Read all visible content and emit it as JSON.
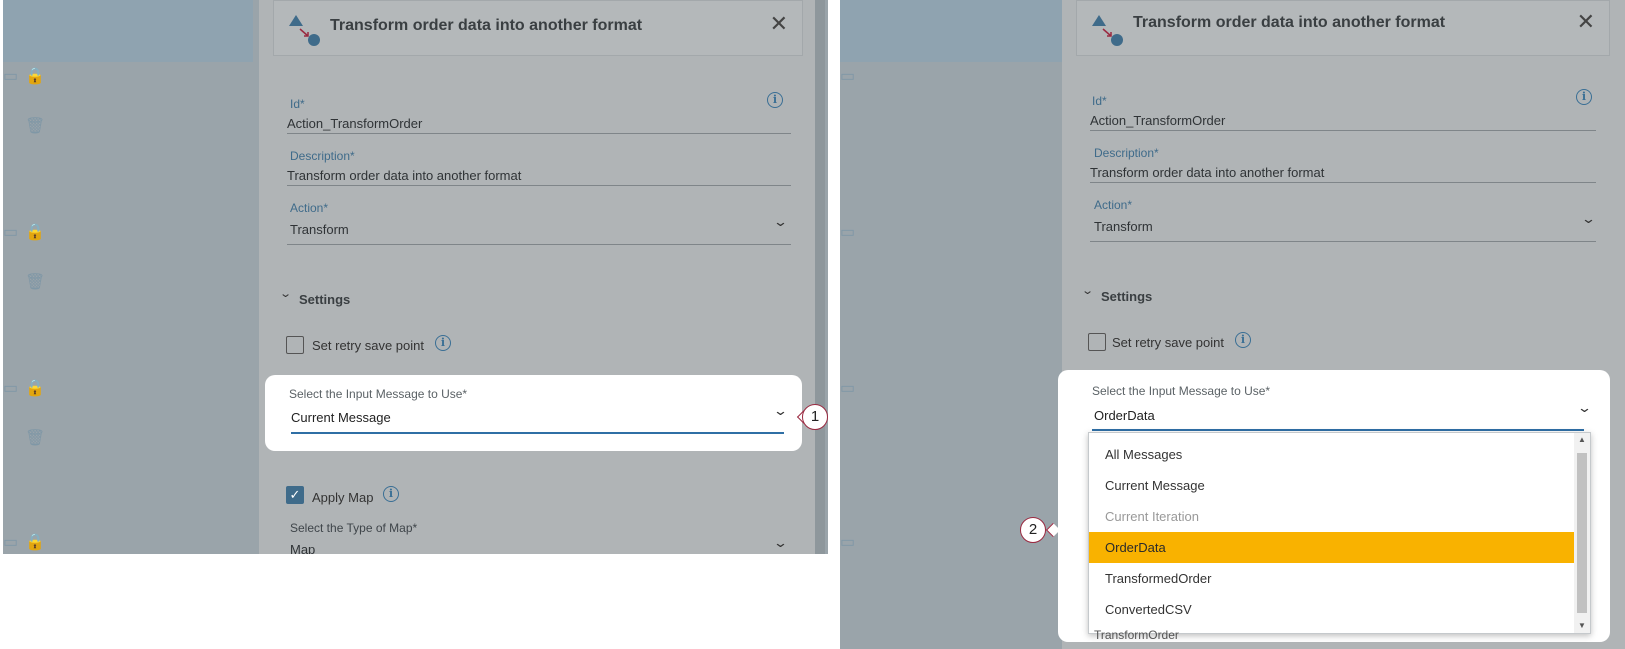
{
  "left": {
    "header_title": "Transform order data into another format",
    "id_label": "Id*",
    "id_value": "Action_TransformOrder",
    "description_label": "Description*",
    "description_value": "Transform order data into another format",
    "action_label": "Action*",
    "action_value": "Transform",
    "settings_label": "Settings",
    "retry_label": "Set retry save point",
    "input_label": "Select the Input Message to Use*",
    "input_value": "Current Message",
    "callout": "1",
    "apply_map_label": "Apply Map",
    "map_type_label": "Select the Type of Map*",
    "map_type_value": "Map"
  },
  "right": {
    "header_title": "Transform order data into another format",
    "id_label": "Id*",
    "id_value": "Action_TransformOrder",
    "description_label": "Description*",
    "description_value": "Transform order data into another format",
    "action_label": "Action*",
    "action_value": "Transform",
    "settings_label": "Settings",
    "retry_label": "Set retry save point",
    "input_label": "Select the Input Message to Use*",
    "input_value": "OrderData",
    "callout": "2",
    "options": [
      "All Messages",
      "Current Message",
      "Current Iteration",
      "OrderData",
      "TransformedOrder",
      "ConvertedCSV"
    ],
    "selected_option": "OrderData",
    "disabled_option": "Current Iteration",
    "below_value": "TransformOrder"
  },
  "icons": {
    "close": "✕",
    "chevron": "⌄",
    "info": "i",
    "check": "✓",
    "settings_chevron": "⌄"
  },
  "colors": {
    "accent_blue": "#2f6fa5",
    "selected_option": "#f9b200",
    "callout_border": "#9a2940"
  }
}
